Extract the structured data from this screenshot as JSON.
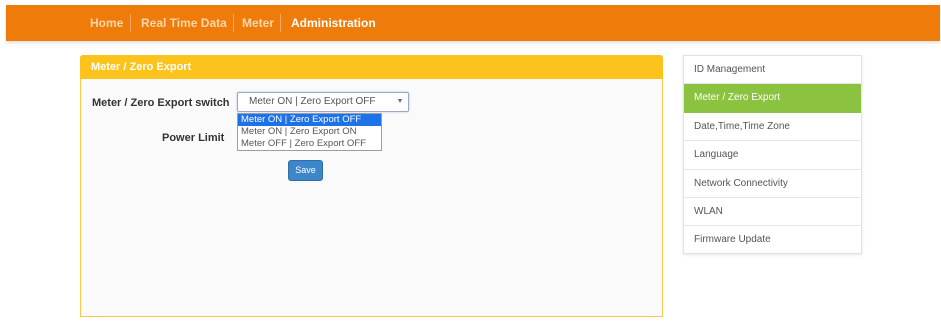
{
  "colors": {
    "topbar": "#ee7b0a",
    "panel_header": "#fcc31c",
    "sidebar_active": "#8bc23f",
    "save_button": "#3d86c9",
    "dropdown_highlight": "#1e72e8"
  },
  "nav": {
    "items": [
      {
        "label": "Home",
        "active": false
      },
      {
        "label": "Real Time Data",
        "active": false
      },
      {
        "label": "Meter",
        "active": false
      },
      {
        "label": "Administration",
        "active": true
      }
    ]
  },
  "panel": {
    "title": "Meter / Zero Export",
    "switch_label": "Meter / Zero Export switch",
    "switch_value": "Meter ON | Zero Export OFF",
    "switch_options": [
      "Meter ON | Zero Export OFF",
      "Meter ON | Zero Export ON",
      "Meter OFF | Zero Export OFF"
    ],
    "power_limit_label": "Power Limit",
    "save_label": "Save"
  },
  "sidebar": {
    "items": [
      {
        "label": "ID Management",
        "active": false
      },
      {
        "label": "Meter / Zero Export",
        "active": true
      },
      {
        "label": "Date,Time,Time Zone",
        "active": false
      },
      {
        "label": "Language",
        "active": false
      },
      {
        "label": "Network Connectivity",
        "active": false
      },
      {
        "label": "WLAN",
        "active": false
      },
      {
        "label": "Firmware Update",
        "active": false
      }
    ]
  }
}
